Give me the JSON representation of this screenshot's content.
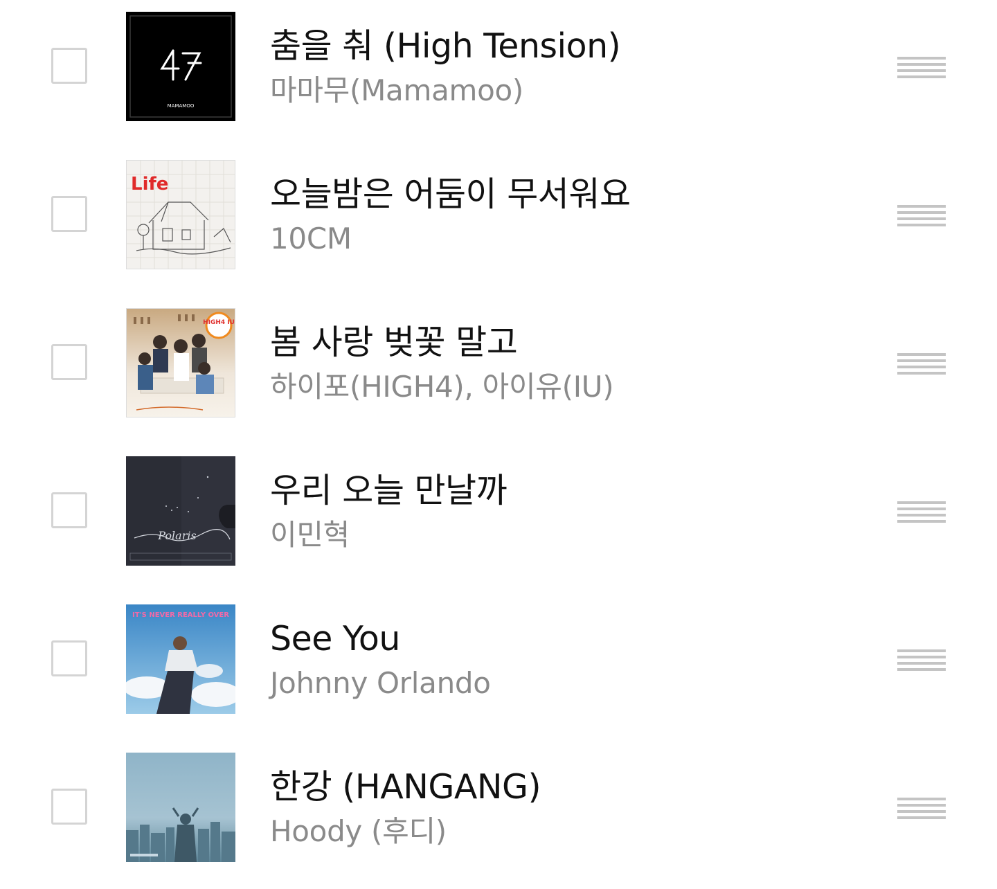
{
  "playlist": {
    "items": [
      {
        "title": "춤을 춰 (High Tension)",
        "artist": "마마무(Mamamoo)",
        "cover_text": "MAMAMOO"
      },
      {
        "title": "오늘밤은 어둠이 무서워요",
        "artist": "10CM",
        "cover_text": "Life"
      },
      {
        "title": "봄 사랑 벚꽃 말고",
        "artist": "하이포(HIGH4), 아이유(IU)",
        "cover_text": "HIGH4 IU"
      },
      {
        "title": "우리 오늘 만날까",
        "artist": "이민혁",
        "cover_text": "Polaris"
      },
      {
        "title": "See You",
        "artist": "Johnny Orlando",
        "cover_text": "IT'S NEVER REALLY OVER"
      },
      {
        "title": "한강 (HANGANG)",
        "artist": "Hoody (후디)",
        "cover_text": ""
      }
    ]
  },
  "colors": {
    "title": "#111111",
    "artist": "#8a8a8a",
    "checkbox_border": "#d4d4d4",
    "drag_handle": "#c4c4c4"
  }
}
